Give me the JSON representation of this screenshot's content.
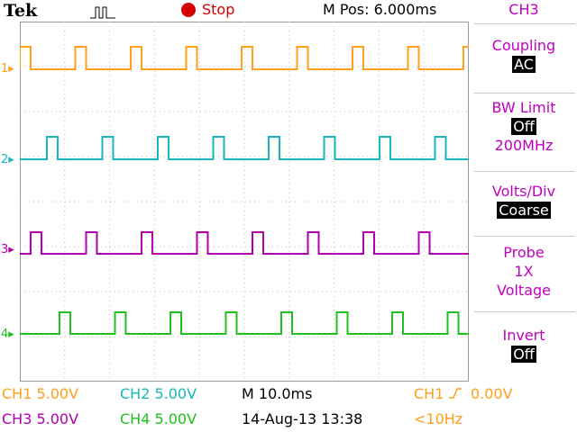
{
  "header": {
    "brand": "Tek",
    "run_state": "Stop",
    "m_pos": "M Pos: 6.000ms"
  },
  "traces": [
    {
      "label": "1",
      "color": "#ff9f1c"
    },
    {
      "label": "2",
      "color": "#19b6bd"
    },
    {
      "label": "3",
      "color": "#b000b0"
    },
    {
      "label": "4",
      "color": "#1fc01f"
    }
  ],
  "menu": {
    "title": "CH3",
    "coupling": {
      "label": "Coupling",
      "value": "AC"
    },
    "bw_limit": {
      "label": "BW Limit",
      "value": "Off",
      "extra": "200MHz"
    },
    "volts_div": {
      "label": "Volts/Div",
      "value": "Coarse"
    },
    "probe": {
      "label": "Probe",
      "value1": "1X",
      "value2": "Voltage"
    },
    "invert": {
      "label": "Invert",
      "value": "Off"
    }
  },
  "status": {
    "ch1": "CH1  5.00V",
    "ch2": "CH2  5.00V",
    "ch3": "CH3  5.00V",
    "ch4": "CH4  5.00V",
    "timebase": "M 10.0ms",
    "trigger": "0.00V",
    "trigger_src": "CH1",
    "date": "14-Aug-13 13:38",
    "freq": "<10Hz"
  },
  "colors": {
    "ch1": "#ff9f1c",
    "ch2": "#19b6bd",
    "ch3": "#b000b0",
    "ch4": "#1fc01f",
    "menu": "#c000c0"
  }
}
